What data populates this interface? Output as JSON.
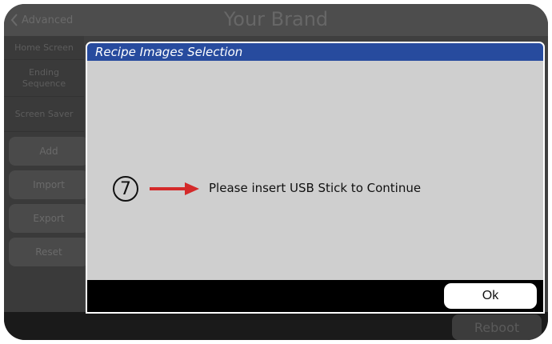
{
  "header": {
    "back_label": "Advanced",
    "title": "Your Brand"
  },
  "sidebar": {
    "items": [
      {
        "label": "Home Screen"
      },
      {
        "label": "Ending Sequence"
      },
      {
        "label": "Screen Saver"
      }
    ],
    "buttons": [
      {
        "label": "Add"
      },
      {
        "label": "Import"
      },
      {
        "label": "Export"
      },
      {
        "label": "Reset"
      }
    ]
  },
  "footer": {
    "reboot_label": "Reboot"
  },
  "modal": {
    "title": "Recipe Images Selection",
    "step_number": "7",
    "message": "Please insert USB Stick to Continue",
    "ok_label": "Ok"
  },
  "colors": {
    "modal_header": "#274b9e",
    "arrow": "#d42a2a",
    "background": "#3f3f3f"
  }
}
